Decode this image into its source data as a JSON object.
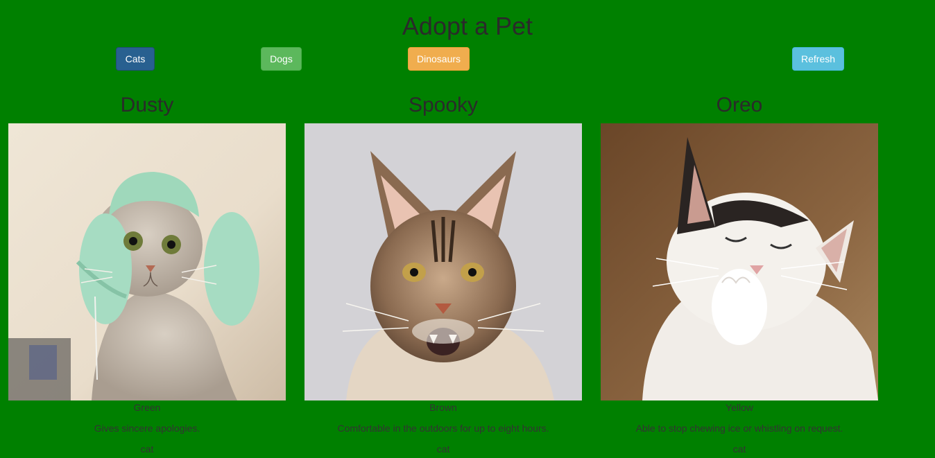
{
  "header": {
    "title": "Adopt a Pet"
  },
  "toolbar": {
    "cats_label": "Cats",
    "dogs_label": "Dogs",
    "dinosaurs_label": "Dinosaurs",
    "refresh_label": "Refresh"
  },
  "colors": {
    "background": "#008000",
    "cats_button": "#286090",
    "dogs_button": "#5cb85c",
    "dinosaurs_button": "#f0ad4e",
    "refresh_button": "#5bc0de"
  },
  "pets": [
    {
      "name": "Dusty",
      "color": "Green",
      "trait": "Gives sincere apologies.",
      "species": "cat",
      "photo_icon": "cat-in-knit-hat-image"
    },
    {
      "name": "Spooky",
      "color": "Brown",
      "trait": "Comfortable in the outdoors for up to eight hours.",
      "species": "cat",
      "photo_icon": "tabby-cat-image"
    },
    {
      "name": "Oreo",
      "color": "Yellow",
      "trait": "Able to stop chewing ice or whistling on request.",
      "species": "cat",
      "photo_icon": "laughing-cat-image"
    }
  ]
}
